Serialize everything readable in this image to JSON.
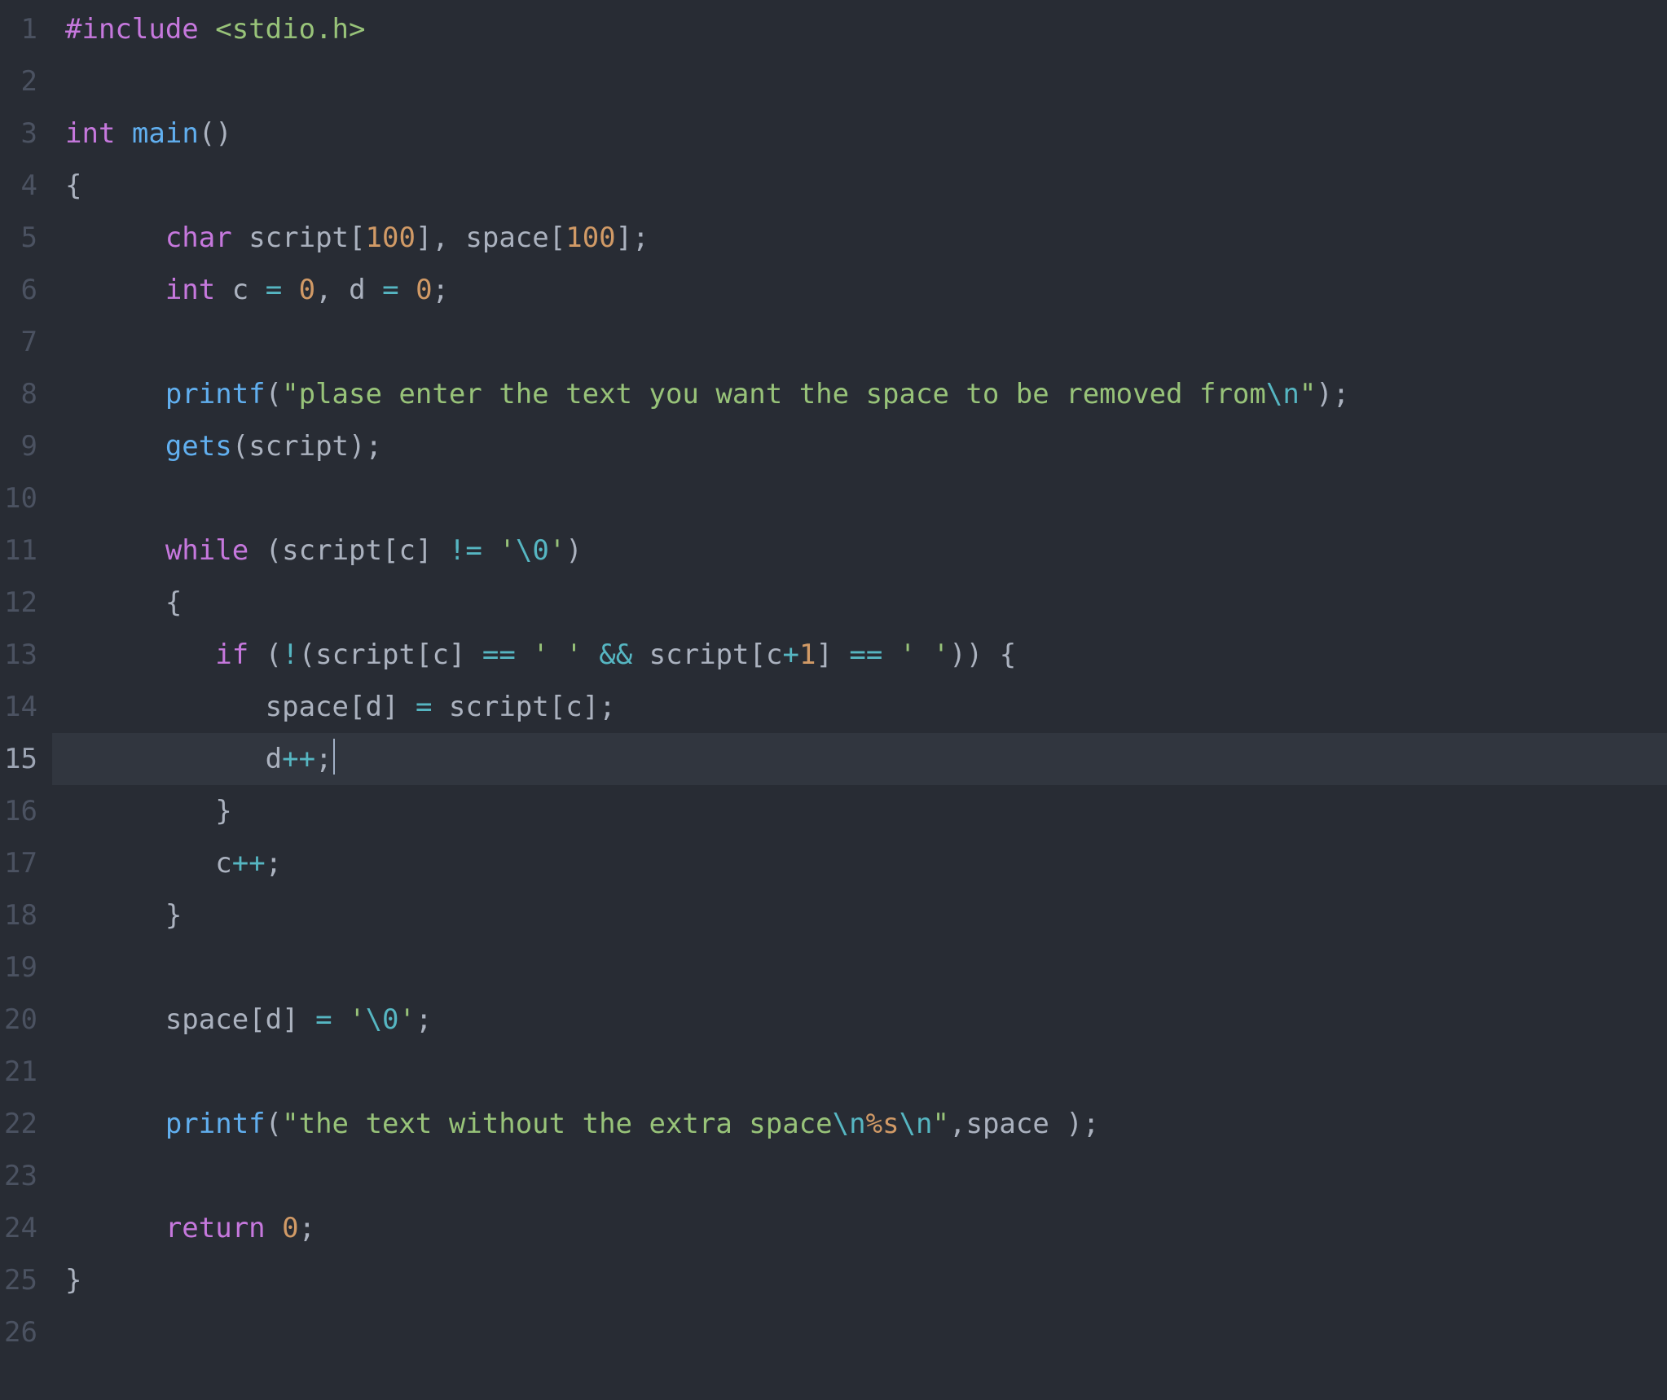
{
  "editor": {
    "theme": "one-dark",
    "language": "c",
    "active_line": 15,
    "cursor_line": 15,
    "cursor_after_token_index": 5,
    "line_count": 26,
    "lines": [
      {
        "n": 1,
        "indent": 0,
        "tokens": [
          {
            "t": "preproc",
            "v": "#include"
          },
          {
            "t": "punct",
            "v": " "
          },
          {
            "t": "header",
            "v": "<stdio.h>"
          }
        ]
      },
      {
        "n": 2,
        "indent": 0,
        "tokens": []
      },
      {
        "n": 3,
        "indent": 0,
        "tokens": [
          {
            "t": "type",
            "v": "int"
          },
          {
            "t": "punct",
            "v": " "
          },
          {
            "t": "funcdecl",
            "v": "main"
          },
          {
            "t": "paren",
            "v": "()"
          }
        ]
      },
      {
        "n": 4,
        "indent": 0,
        "tokens": [
          {
            "t": "brace",
            "v": "{"
          }
        ]
      },
      {
        "n": 5,
        "indent": 2,
        "tokens": [
          {
            "t": "type",
            "v": "char"
          },
          {
            "t": "punct",
            "v": " "
          },
          {
            "t": "ident",
            "v": "script"
          },
          {
            "t": "bracket",
            "v": "["
          },
          {
            "t": "number",
            "v": "100"
          },
          {
            "t": "bracket",
            "v": "]"
          },
          {
            "t": "comma",
            "v": ","
          },
          {
            "t": "punct",
            "v": " "
          },
          {
            "t": "ident",
            "v": "space"
          },
          {
            "t": "bracket",
            "v": "["
          },
          {
            "t": "number",
            "v": "100"
          },
          {
            "t": "bracket",
            "v": "]"
          },
          {
            "t": "semicolon",
            "v": ";"
          }
        ]
      },
      {
        "n": 6,
        "indent": 2,
        "tokens": [
          {
            "t": "type",
            "v": "int"
          },
          {
            "t": "punct",
            "v": " "
          },
          {
            "t": "ident",
            "v": "c"
          },
          {
            "t": "punct",
            "v": " "
          },
          {
            "t": "op",
            "v": "="
          },
          {
            "t": "punct",
            "v": " "
          },
          {
            "t": "number",
            "v": "0"
          },
          {
            "t": "comma",
            "v": ","
          },
          {
            "t": "punct",
            "v": " "
          },
          {
            "t": "ident",
            "v": "d"
          },
          {
            "t": "punct",
            "v": " "
          },
          {
            "t": "op",
            "v": "="
          },
          {
            "t": "punct",
            "v": " "
          },
          {
            "t": "number",
            "v": "0"
          },
          {
            "t": "semicolon",
            "v": ";"
          }
        ]
      },
      {
        "n": 7,
        "indent": 0,
        "tokens": []
      },
      {
        "n": 8,
        "indent": 2,
        "tokens": [
          {
            "t": "func",
            "v": "printf"
          },
          {
            "t": "paren",
            "v": "("
          },
          {
            "t": "string",
            "v": "\"plase enter the text you want the space to be removed from"
          },
          {
            "t": "escape",
            "v": "\\n"
          },
          {
            "t": "string",
            "v": "\""
          },
          {
            "t": "paren",
            "v": ")"
          },
          {
            "t": "semicolon",
            "v": ";"
          }
        ]
      },
      {
        "n": 9,
        "indent": 2,
        "tokens": [
          {
            "t": "func",
            "v": "gets"
          },
          {
            "t": "paren",
            "v": "("
          },
          {
            "t": "ident",
            "v": "script"
          },
          {
            "t": "paren",
            "v": ")"
          },
          {
            "t": "semicolon",
            "v": ";"
          }
        ]
      },
      {
        "n": 10,
        "indent": 0,
        "tokens": []
      },
      {
        "n": 11,
        "indent": 2,
        "tokens": [
          {
            "t": "keyword",
            "v": "while"
          },
          {
            "t": "punct",
            "v": " "
          },
          {
            "t": "paren",
            "v": "("
          },
          {
            "t": "ident",
            "v": "script"
          },
          {
            "t": "bracket",
            "v": "["
          },
          {
            "t": "ident",
            "v": "c"
          },
          {
            "t": "bracket",
            "v": "]"
          },
          {
            "t": "punct",
            "v": " "
          },
          {
            "t": "op",
            "v": "!="
          },
          {
            "t": "punct",
            "v": " "
          },
          {
            "t": "string",
            "v": "'"
          },
          {
            "t": "escape",
            "v": "\\0"
          },
          {
            "t": "string",
            "v": "'"
          },
          {
            "t": "paren",
            "v": ")"
          }
        ]
      },
      {
        "n": 12,
        "indent": 2,
        "tokens": [
          {
            "t": "brace",
            "v": "{"
          }
        ]
      },
      {
        "n": 13,
        "indent": 3,
        "tokens": [
          {
            "t": "keyword",
            "v": "if"
          },
          {
            "t": "punct",
            "v": " "
          },
          {
            "t": "paren",
            "v": "("
          },
          {
            "t": "op",
            "v": "!"
          },
          {
            "t": "paren",
            "v": "("
          },
          {
            "t": "ident",
            "v": "script"
          },
          {
            "t": "bracket",
            "v": "["
          },
          {
            "t": "ident",
            "v": "c"
          },
          {
            "t": "bracket",
            "v": "]"
          },
          {
            "t": "punct",
            "v": " "
          },
          {
            "t": "op",
            "v": "=="
          },
          {
            "t": "punct",
            "v": " "
          },
          {
            "t": "string",
            "v": "' '"
          },
          {
            "t": "punct",
            "v": " "
          },
          {
            "t": "op",
            "v": "&&"
          },
          {
            "t": "punct",
            "v": " "
          },
          {
            "t": "ident",
            "v": "script"
          },
          {
            "t": "bracket",
            "v": "["
          },
          {
            "t": "ident",
            "v": "c"
          },
          {
            "t": "op",
            "v": "+"
          },
          {
            "t": "number",
            "v": "1"
          },
          {
            "t": "bracket",
            "v": "]"
          },
          {
            "t": "punct",
            "v": " "
          },
          {
            "t": "op",
            "v": "=="
          },
          {
            "t": "punct",
            "v": " "
          },
          {
            "t": "string",
            "v": "' '"
          },
          {
            "t": "paren",
            "v": "))"
          },
          {
            "t": "punct",
            "v": " "
          },
          {
            "t": "brace",
            "v": "{"
          }
        ]
      },
      {
        "n": 14,
        "indent": 4,
        "tokens": [
          {
            "t": "ident",
            "v": "space"
          },
          {
            "t": "bracket",
            "v": "["
          },
          {
            "t": "ident",
            "v": "d"
          },
          {
            "t": "bracket",
            "v": "]"
          },
          {
            "t": "punct",
            "v": " "
          },
          {
            "t": "op",
            "v": "="
          },
          {
            "t": "punct",
            "v": " "
          },
          {
            "t": "ident",
            "v": "script"
          },
          {
            "t": "bracket",
            "v": "["
          },
          {
            "t": "ident",
            "v": "c"
          },
          {
            "t": "bracket",
            "v": "]"
          },
          {
            "t": "semicolon",
            "v": ";"
          }
        ]
      },
      {
        "n": 15,
        "indent": 4,
        "tokens": [
          {
            "t": "ident",
            "v": "d"
          },
          {
            "t": "op",
            "v": "++"
          },
          {
            "t": "semicolon",
            "v": ";"
          }
        ]
      },
      {
        "n": 16,
        "indent": 3,
        "tokens": [
          {
            "t": "brace",
            "v": "}"
          }
        ]
      },
      {
        "n": 17,
        "indent": 3,
        "tokens": [
          {
            "t": "ident",
            "v": "c"
          },
          {
            "t": "op",
            "v": "++"
          },
          {
            "t": "semicolon",
            "v": ";"
          }
        ]
      },
      {
        "n": 18,
        "indent": 2,
        "tokens": [
          {
            "t": "brace",
            "v": "}"
          }
        ]
      },
      {
        "n": 19,
        "indent": 0,
        "tokens": []
      },
      {
        "n": 20,
        "indent": 2,
        "tokens": [
          {
            "t": "ident",
            "v": "space"
          },
          {
            "t": "bracket",
            "v": "["
          },
          {
            "t": "ident",
            "v": "d"
          },
          {
            "t": "bracket",
            "v": "]"
          },
          {
            "t": "punct",
            "v": " "
          },
          {
            "t": "op",
            "v": "="
          },
          {
            "t": "punct",
            "v": " "
          },
          {
            "t": "string",
            "v": "'"
          },
          {
            "t": "escape",
            "v": "\\0"
          },
          {
            "t": "string",
            "v": "'"
          },
          {
            "t": "semicolon",
            "v": ";"
          }
        ]
      },
      {
        "n": 21,
        "indent": 0,
        "tokens": []
      },
      {
        "n": 22,
        "indent": 2,
        "tokens": [
          {
            "t": "func",
            "v": "printf"
          },
          {
            "t": "paren",
            "v": "("
          },
          {
            "t": "string",
            "v": "\"the text without the extra space"
          },
          {
            "t": "escape",
            "v": "\\n"
          },
          {
            "t": "fmt",
            "v": "%s"
          },
          {
            "t": "escape",
            "v": "\\n"
          },
          {
            "t": "string",
            "v": "\""
          },
          {
            "t": "comma",
            "v": ","
          },
          {
            "t": "ident",
            "v": "space"
          },
          {
            "t": "punct",
            "v": " "
          },
          {
            "t": "paren",
            "v": ")"
          },
          {
            "t": "semicolon",
            "v": ";"
          }
        ]
      },
      {
        "n": 23,
        "indent": 0,
        "tokens": []
      },
      {
        "n": 24,
        "indent": 2,
        "tokens": [
          {
            "t": "keyword",
            "v": "return"
          },
          {
            "t": "punct",
            "v": " "
          },
          {
            "t": "number",
            "v": "0"
          },
          {
            "t": "semicolon",
            "v": ";"
          }
        ]
      },
      {
        "n": 25,
        "indent": 0,
        "tokens": [
          {
            "t": "brace",
            "v": "}"
          }
        ]
      },
      {
        "n": 26,
        "indent": 0,
        "tokens": []
      }
    ]
  },
  "indent_unit": "   "
}
